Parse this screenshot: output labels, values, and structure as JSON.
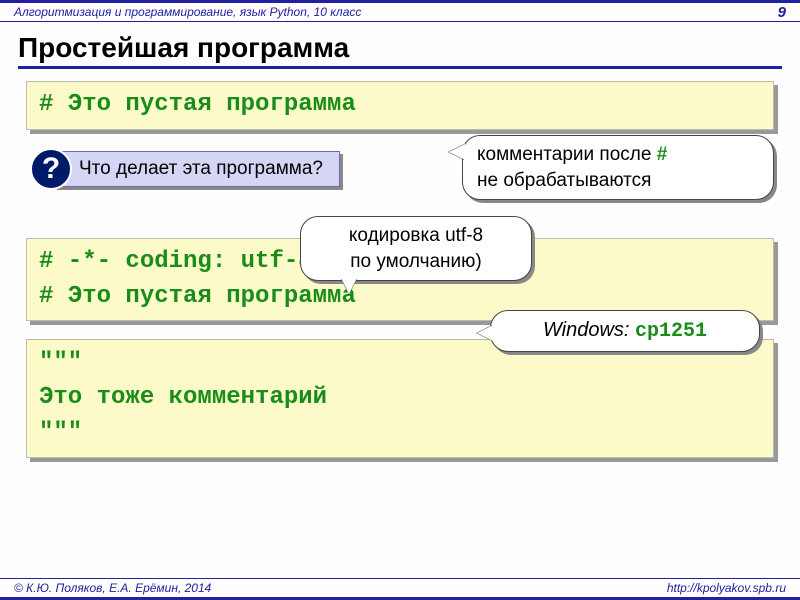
{
  "header": {
    "left": "Алгоритмизация и программирование, язык Python, 10 класс",
    "page": "9"
  },
  "title": "Простейшая программа",
  "code1": "# Это пустая программа",
  "question": {
    "mark": "?",
    "text": " Что делает эта программа?"
  },
  "callout1": {
    "line1_prefix": "комментарии после ",
    "hash": "#",
    "line2": "не обрабатываются"
  },
  "callout2": {
    "line1": "кодировка utf-8",
    "line2": "по умолчанию)"
  },
  "code2": {
    "line1": "# -*- coding: utf-8 -*-",
    "line2": "# Это пустая программа"
  },
  "callout3": {
    "label": "Windows:",
    "value": "cp1251"
  },
  "code3": {
    "q1": "\"\"\"",
    "body": "Это тоже комментарий",
    "q2": "\"\"\""
  },
  "footer": {
    "left": "© К.Ю. Поляков, Е.А. Ерёмин, 2014",
    "right": "http://kpolyakov.spb.ru"
  }
}
